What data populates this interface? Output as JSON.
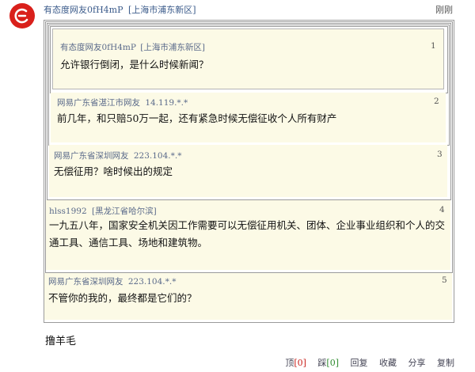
{
  "post": {
    "user": "有态度网友0fH4mP",
    "location": "[上海市浦东新区]",
    "time": "刚刚",
    "comment": "撸羊毛"
  },
  "floors": [
    {
      "user": "有态度网友0fH4mP",
      "location": "[上海市浦东新区]",
      "num": "1",
      "text": "允许银行倒闭，是什么时候新闻？"
    },
    {
      "user": "网易广东省湛江市网友",
      "location": "14.119.*.*",
      "num": "2",
      "text": "前几年，和只赔50万一起，还有紧急时候无偿征收个人所有财产"
    },
    {
      "user": "网易广东省深圳网友",
      "location": "223.104.*.*",
      "num": "3",
      "text": "无偿征用？啥时候出的规定"
    },
    {
      "user": "hlss1992",
      "location": "[黑龙江省哈尔滨]",
      "num": "4",
      "text": "一九五八年，国家安全机关因工作需要可以无偿征用机关、团体、企业事业组织和个人的交通工具、通信工具、场地和建筑物。"
    },
    {
      "user": "网易广东省深圳网友",
      "location": "223.104.*.*",
      "num": "5",
      "text": "不管你的我的，最终都是它们的？"
    }
  ],
  "actions": {
    "up_label": "顶",
    "up_count": "[0]",
    "down_label": "踩",
    "down_count": "[0]",
    "reply": "回复",
    "favorite": "收藏",
    "share": "分享",
    "copy": "复制"
  },
  "colors": {
    "brand_red": "#d9201b",
    "floor_bg": "#fcfae6",
    "border": "#9a9a9a"
  },
  "icons": {
    "avatar": "netease-logo-icon"
  }
}
